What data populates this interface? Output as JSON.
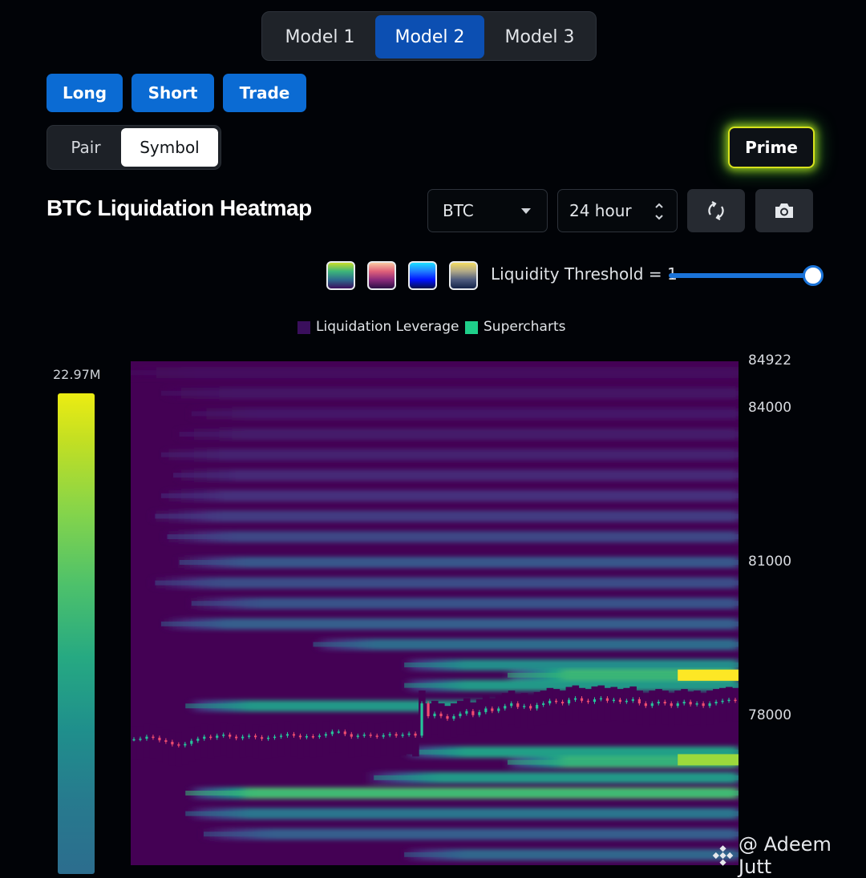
{
  "models": {
    "items": [
      "Model 1",
      "Model 2",
      "Model 3"
    ],
    "active": "Model 2"
  },
  "actions": {
    "long": "Long",
    "short": "Short",
    "trade": "Trade"
  },
  "toggle": {
    "pair": "Pair",
    "symbol": "Symbol",
    "active": "Symbol"
  },
  "prime": "Prime",
  "title": "BTC Liquidation Heatmap",
  "controls": {
    "asset": "BTC",
    "timeframe": "24 hour",
    "refresh_icon": "refresh-icon",
    "camera_icon": "camera-icon"
  },
  "palettes": [
    "viridis",
    "magma",
    "jet",
    "cividis"
  ],
  "threshold": {
    "label": "Liquidity Threshold = 1",
    "value": 1,
    "slider_fraction": 1.0
  },
  "watermark": "@ Adeem Jutt",
  "colors": {
    "background": "#010307",
    "accent": "#0b6bd3",
    "heat_low": "#440154",
    "heat_high": "#fde725",
    "candle_up": "#26c49a",
    "candle_down": "#ef4d6f"
  },
  "chart_data": {
    "type": "heatmap",
    "legend": [
      "Liquidation Leverage",
      "Supercharts"
    ],
    "legend_colors": [
      "#3a0f5c",
      "#1fcf8a"
    ],
    "scale_max_label": "22.97M",
    "yticks": [
      "84922",
      "84000",
      "81000",
      "78000"
    ],
    "ylim": [
      75000,
      84922
    ],
    "x_steps": 48,
    "bands": [
      {
        "price": 84700,
        "start": 0.0,
        "intensity": 0.04
      },
      {
        "price": 84300,
        "start": 0.05,
        "intensity": 0.06
      },
      {
        "price": 83900,
        "start": 0.1,
        "intensity": 0.07
      },
      {
        "price": 83500,
        "start": 0.08,
        "intensity": 0.08
      },
      {
        "price": 83100,
        "start": 0.05,
        "intensity": 0.1
      },
      {
        "price": 82700,
        "start": 0.07,
        "intensity": 0.12
      },
      {
        "price": 82300,
        "start": 0.05,
        "intensity": 0.14
      },
      {
        "price": 81900,
        "start": 0.04,
        "intensity": 0.18
      },
      {
        "price": 81500,
        "start": 0.06,
        "intensity": 0.22
      },
      {
        "price": 81000,
        "start": 0.08,
        "intensity": 0.28
      },
      {
        "price": 80600,
        "start": 0.04,
        "intensity": 0.24
      },
      {
        "price": 80200,
        "start": 0.1,
        "intensity": 0.26
      },
      {
        "price": 79800,
        "start": 0.05,
        "intensity": 0.3
      },
      {
        "price": 79400,
        "start": 0.3,
        "intensity": 0.36
      },
      {
        "price": 79000,
        "start": 0.45,
        "intensity": 0.5
      },
      {
        "price": 78800,
        "start": 0.62,
        "intensity": 0.68
      },
      {
        "price": 78600,
        "start": 0.45,
        "intensity": 0.55
      },
      {
        "price": 78200,
        "start": 0.09,
        "intensity": 0.55
      },
      {
        "price": 77300,
        "start": 0.45,
        "intensity": 0.58
      },
      {
        "price": 77100,
        "start": 0.62,
        "intensity": 0.66
      },
      {
        "price": 76800,
        "start": 0.4,
        "intensity": 0.55
      },
      {
        "price": 76500,
        "start": 0.09,
        "intensity": 0.7
      },
      {
        "price": 76100,
        "start": 0.09,
        "intensity": 0.4
      },
      {
        "price": 75700,
        "start": 0.12,
        "intensity": 0.3
      },
      {
        "price": 75300,
        "start": 0.45,
        "intensity": 0.34
      }
    ],
    "hotspots": [
      {
        "price": 78800,
        "start": 0.9,
        "intensity": 1.0
      },
      {
        "price": 77150,
        "start": 0.9,
        "intensity": 0.85
      }
    ],
    "price_series": [
      77550,
      77560,
      77600,
      77580,
      77530,
      77500,
      77450,
      77430,
      77460,
      77520,
      77560,
      77600,
      77580,
      77620,
      77640,
      77600,
      77570,
      77600,
      77620,
      77590,
      77560,
      77580,
      77600,
      77620,
      77650,
      77620,
      77590,
      77610,
      77600,
      77620,
      77650,
      77700,
      77700,
      77650,
      77600,
      77620,
      77640,
      77620,
      77600,
      77630,
      77650,
      77620,
      77640,
      77660,
      77620,
      78250,
      78000,
      78050,
      78000,
      77950,
      78000,
      78050,
      78100,
      78020,
      78080,
      78150,
      78100,
      78150,
      78200,
      78250,
      78180,
      78200,
      78150,
      78220,
      78250,
      78300,
      78280,
      78250,
      78320,
      78350,
      78300,
      78280,
      78330,
      78350,
      78300,
      78320,
      78280,
      78300,
      78330,
      78250,
      78200,
      78250,
      78280,
      78250,
      78200,
      78250,
      78280,
      78230,
      78250,
      78200,
      78250,
      78280,
      78300,
      78320,
      78300
    ]
  }
}
